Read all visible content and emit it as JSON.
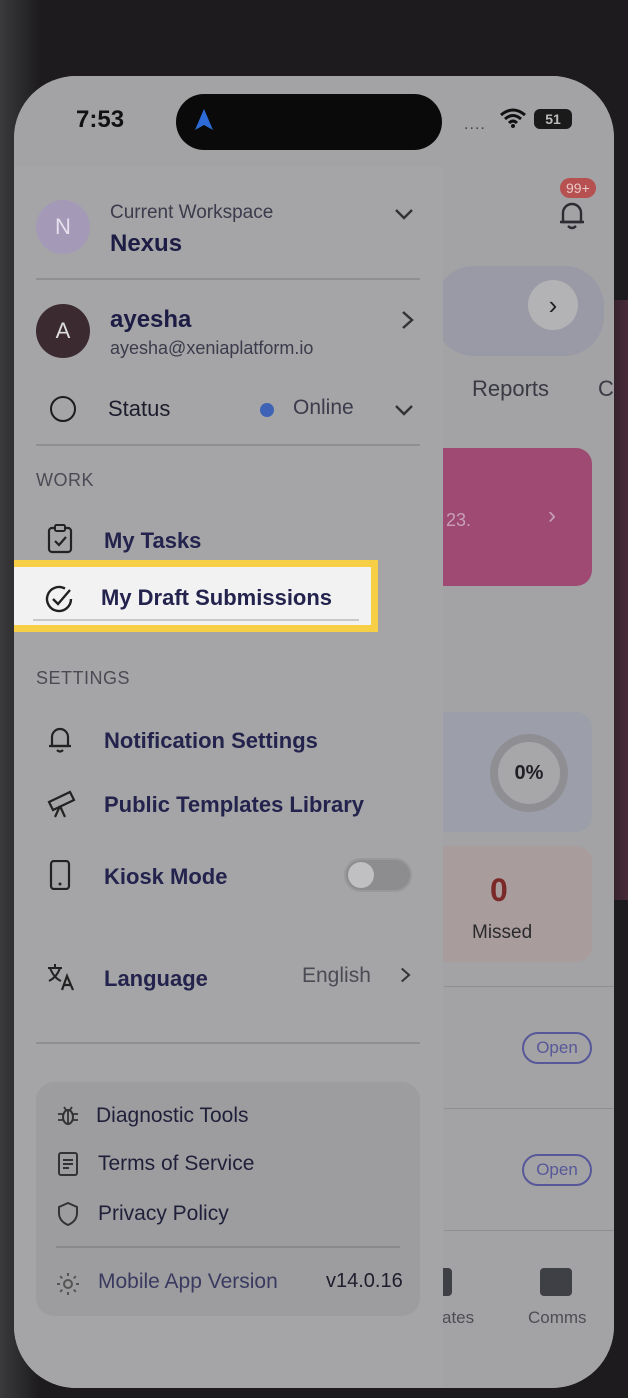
{
  "status_bar": {
    "time": "7:53",
    "signal": "....",
    "battery": "51"
  },
  "background_app": {
    "notification_badge": "99+",
    "tabs": [
      "Reports",
      "C"
    ],
    "banner_text": "23.",
    "progress_percent": "0%",
    "missed_count": "0",
    "missed_label": "Missed",
    "open_badges": [
      "Open",
      "Open"
    ],
    "bottom_nav": [
      "ates",
      "Comms"
    ]
  },
  "drawer": {
    "workspace": {
      "avatar_initial": "N",
      "label": "Current Workspace",
      "name": "Nexus"
    },
    "user": {
      "avatar_initial": "A",
      "name": "ayesha",
      "email": "ayesha@xeniaplatform.io"
    },
    "status": {
      "label": "Status",
      "value": "Online",
      "dot_color": "#3e63b6"
    },
    "work_section": {
      "title": "WORK",
      "items": [
        {
          "label": "My Tasks",
          "icon": "clipboard-check-icon"
        },
        {
          "label": "My Draft Submissions",
          "icon": "circle-check-icon",
          "highlighted": true
        }
      ]
    },
    "settings_section": {
      "title": "SETTINGS",
      "items": [
        {
          "label": "Notification Settings",
          "icon": "bell-icon"
        },
        {
          "label": "Public Templates Library",
          "icon": "telescope-icon"
        },
        {
          "label": "Kiosk Mode",
          "icon": "tablet-icon",
          "toggle": false
        },
        {
          "label": "Language",
          "icon": "translate-icon",
          "value": "English"
        }
      ]
    },
    "footer": {
      "items": [
        {
          "label": "Diagnostic Tools",
          "icon": "bug-icon"
        },
        {
          "label": "Terms of Service",
          "icon": "document-icon"
        },
        {
          "label": "Privacy Policy",
          "icon": "shield-icon"
        }
      ],
      "version_label": "Mobile App Version",
      "version_value": "v14.0.16"
    }
  },
  "colors": {
    "highlight_border": "#f7cf47",
    "accent_text": "#23234d"
  }
}
